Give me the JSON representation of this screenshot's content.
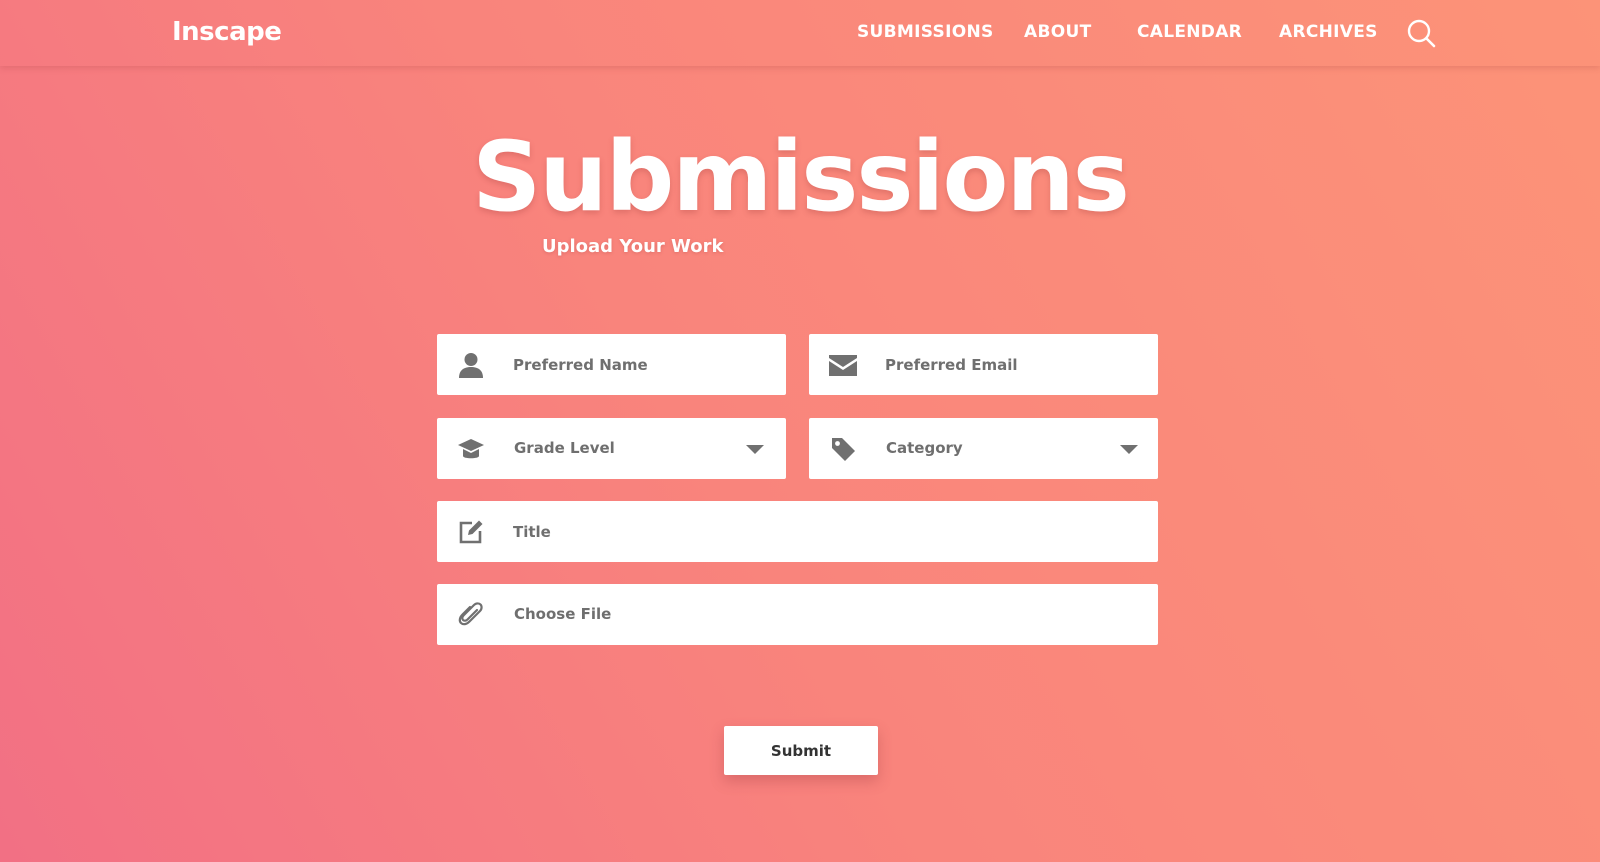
{
  "brand": "Inscape",
  "nav": {
    "items": [
      "SUBMISSIONS",
      "ABOUT",
      "CALENDAR",
      "ARCHIVES"
    ],
    "search_icon": "search-icon"
  },
  "hero": {
    "title": "Submissions",
    "subtitle": "Upload Your Work"
  },
  "form": {
    "name_placeholder": "Preferred Name",
    "email_placeholder": "Preferred Email",
    "grade_label": "Grade Level",
    "category_label": "Category",
    "title_placeholder": "Title",
    "file_label": "Choose File",
    "submit_label": "Submit"
  },
  "colors": {
    "gradient_start": "#f27084",
    "gradient_end": "#fc9378",
    "field_bg": "#ffffff",
    "icon": "#707070"
  }
}
